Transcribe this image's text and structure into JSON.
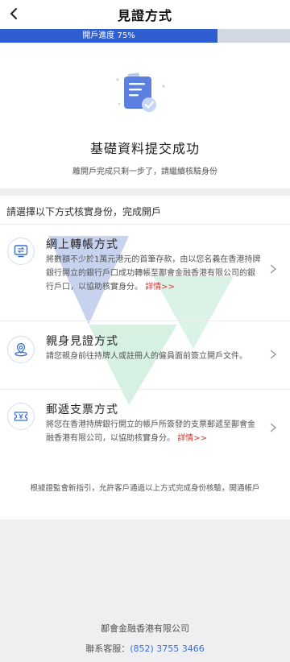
{
  "header": {
    "back_icon": "chevron-left-icon",
    "title": "見證方式"
  },
  "progress": {
    "label": "開戶進度 75%",
    "percent": 75,
    "fill_color": "#2e5ed0",
    "track_color": "#d3d8e3"
  },
  "success": {
    "icon": "document-check-icon",
    "title": "基礎資料提交成功",
    "subtitle": "離開戶完成只剩一步了，請繼續核驗身份"
  },
  "methods": {
    "heading": "請選擇以下方式核實身份，完成開戶",
    "items": [
      {
        "icon": "transfer-screen-icon",
        "title": "網上轉帳方式",
        "desc": "將數額不少於1萬元港元的首筆存款，由以您名義在香港持牌銀行開立的銀行戶口成功轉帳至鄯會金融香港有限公司的銀行戶口，以協助核實身分。",
        "more": "詳情>>"
      },
      {
        "icon": "location-person-icon",
        "title": "親身見證方式",
        "desc": "請您親身前往持牌人或註冊人的僱員面前簽立開戶文件。",
        "more": ""
      },
      {
        "icon": "cheque-icon",
        "title": "郵遞支票方式",
        "desc": "將您在香港持牌銀行開立的帳戶所簽發的支票郵遞至鄯會金融香港有限公司，以協助核實身分。",
        "more": "詳情>>"
      }
    ],
    "notice": "根據證監會新指引，允許客戶通過以上方式完成身份核驗，開通帳戶"
  },
  "footer": {
    "company": "鄯會金融香港有限公司",
    "service_label": "聯系客服：",
    "phone": "(852) 3755 3466"
  },
  "colors": {
    "accent": "#2e5ed0",
    "link": "#3a6fd8",
    "detail": "#d23a3a"
  }
}
